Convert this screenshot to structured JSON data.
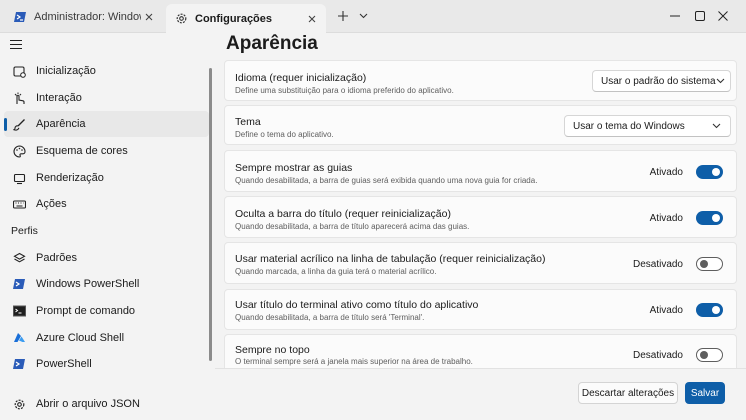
{
  "tabs": [
    {
      "label": "Administrador: Windows PowerShell",
      "icon": "powershell-icon"
    },
    {
      "label": "Configurações",
      "icon": "gear-icon"
    }
  ],
  "sidebar": {
    "items": [
      {
        "label": "Inicialização",
        "icon": "launch-icon"
      },
      {
        "label": "Interação",
        "icon": "interaction-icon"
      },
      {
        "label": "Aparência",
        "icon": "brush-icon",
        "selected": true
      },
      {
        "label": "Esquema de cores",
        "icon": "palette-icon"
      },
      {
        "label": "Renderização",
        "icon": "monitor-icon"
      },
      {
        "label": "Ações",
        "icon": "keyboard-icon"
      }
    ],
    "section_label": "Perfis",
    "profiles": [
      {
        "label": "Padrões",
        "icon": "layers-icon"
      },
      {
        "label": "Windows PowerShell",
        "icon": "powershell-icon"
      },
      {
        "label": "Prompt de comando",
        "icon": "cmd-icon"
      },
      {
        "label": "Azure Cloud Shell",
        "icon": "azure-icon"
      },
      {
        "label": "PowerShell",
        "icon": "powershell-icon"
      }
    ],
    "open_json": "Abrir o arquivo JSON"
  },
  "main": {
    "title": "Aparência",
    "settings": [
      {
        "title": "Idioma (requer inicialização)",
        "desc": "Define uma substituição para o idioma preferido do aplicativo.",
        "control": "dropdown",
        "value": "Usar o padrão do sistema"
      },
      {
        "title": "Tema",
        "desc": "Define o tema do aplicativo.",
        "control": "dropdown",
        "value": "Usar o tema do Windows"
      },
      {
        "title": "Sempre mostrar as guias",
        "desc": "Quando desabilitada, a barra de guias será exibida quando uma nova guia for criada.",
        "control": "toggle",
        "on": true,
        "state": "Ativado"
      },
      {
        "title": "Oculta a barra do título (requer reinicialização)",
        "desc": "Quando desabilitada, a barra de título aparecerá acima das guias.",
        "control": "toggle",
        "on": true,
        "state": "Ativado"
      },
      {
        "title": "Usar material acrílico na linha de tabulação (requer reinicialização)",
        "desc": "Quando marcada, a linha da guia terá o material acrílico.",
        "control": "toggle",
        "on": false,
        "state": "Desativado"
      },
      {
        "title": "Usar título do terminal ativo como título do aplicativo",
        "desc": "Quando desabilitada, a barra de título será 'Terminal'.",
        "control": "toggle",
        "on": true,
        "state": "Ativado"
      },
      {
        "title": "Sempre no topo",
        "desc": "O terminal sempre será a janela mais superior na área de trabalho.",
        "control": "toggle",
        "on": false,
        "state": "Desativado"
      }
    ]
  },
  "footer": {
    "discard_label": "Descartar alterações",
    "save_label": "Salvar"
  },
  "colors": {
    "accent": "#0e5ea8",
    "background": "#f3f3f3",
    "card": "#fbfbfb"
  }
}
